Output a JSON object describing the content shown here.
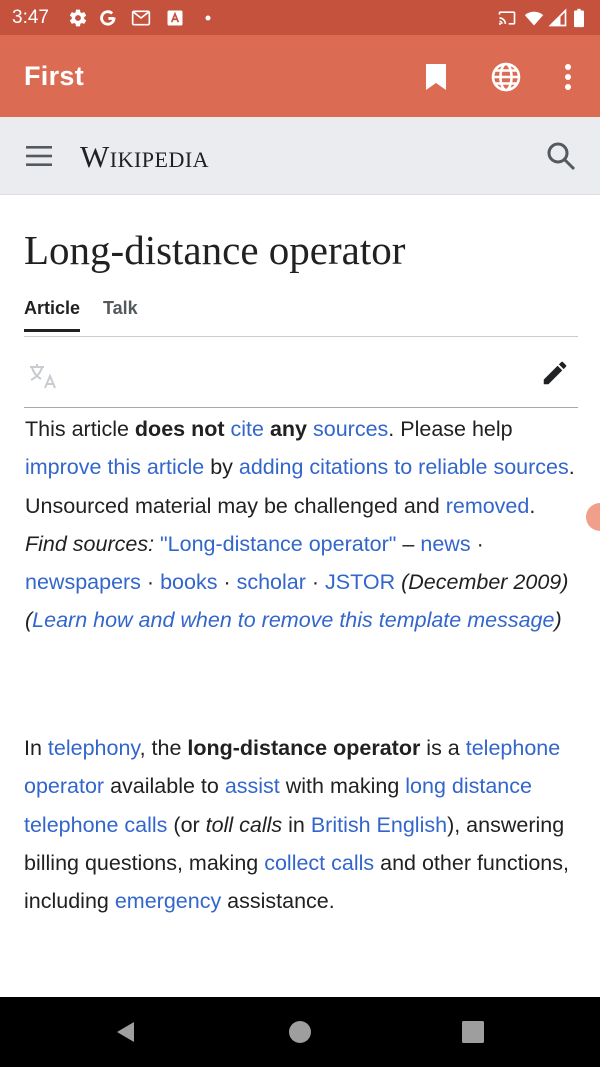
{
  "status_bar": {
    "time": "3:47",
    "left_icons": [
      "gear-icon",
      "google-icon",
      "gmail-icon",
      "text-a-icon",
      "dot-icon"
    ],
    "right_icons": [
      "cast-icon",
      "wifi-icon",
      "cell-signal-icon",
      "battery-icon"
    ]
  },
  "app_bar": {
    "title": "First",
    "actions": [
      "bookmark-icon",
      "globe-icon",
      "more-vert-icon"
    ]
  },
  "wiki_header": {
    "wordmark": "Wikipedia"
  },
  "article": {
    "title": "Long-distance operator",
    "tabs": [
      {
        "label": "Article",
        "active": true
      },
      {
        "label": "Talk",
        "active": false
      }
    ]
  },
  "ambox": {
    "t1": "This article ",
    "b1": "does not",
    "l1": "cite",
    "b2": "any",
    "l2": "sources",
    "t2": ". Please help ",
    "l3": "improve this article",
    "t3": " by ",
    "l4": "adding citations to reliable sources",
    "t4": ". Unsourced material may be challenged and ",
    "l5": "removed",
    "t5": ".",
    "find_label": "Find sources:",
    "l6": "\"Long-distance operator\"",
    "dash": "–",
    "l7": "news",
    "sep": "·",
    "l8": "newspapers",
    "l9": "books",
    "l10": "scholar",
    "l11": "JSTOR",
    "date": "(December 2009)",
    "paren_open": "(",
    "l12": "Learn how and when to remove this template message",
    "paren_close": ")"
  },
  "paragraph": {
    "t1": "In ",
    "l1": "telephony",
    "t2": ", the ",
    "b1": "long-distance operator",
    "t3": " is a ",
    "l2": "telephone operator",
    "t4": " available to ",
    "l3": "assist",
    "t5": " with making ",
    "l4": "long distance telephone calls",
    "t6": " (or ",
    "i1": "toll calls",
    "t7": " in ",
    "l5": "British English",
    "t8": "), answering billing questions, making ",
    "l6": "collect calls",
    "t9": " and other functions, including ",
    "l7": "emergency",
    "t10": " assistance."
  },
  "colors": {
    "status_bar": "#c5523d",
    "app_bar": "#db6b53",
    "wiki_header": "#eaecf0",
    "link": "#3366cc",
    "text": "#202122"
  }
}
